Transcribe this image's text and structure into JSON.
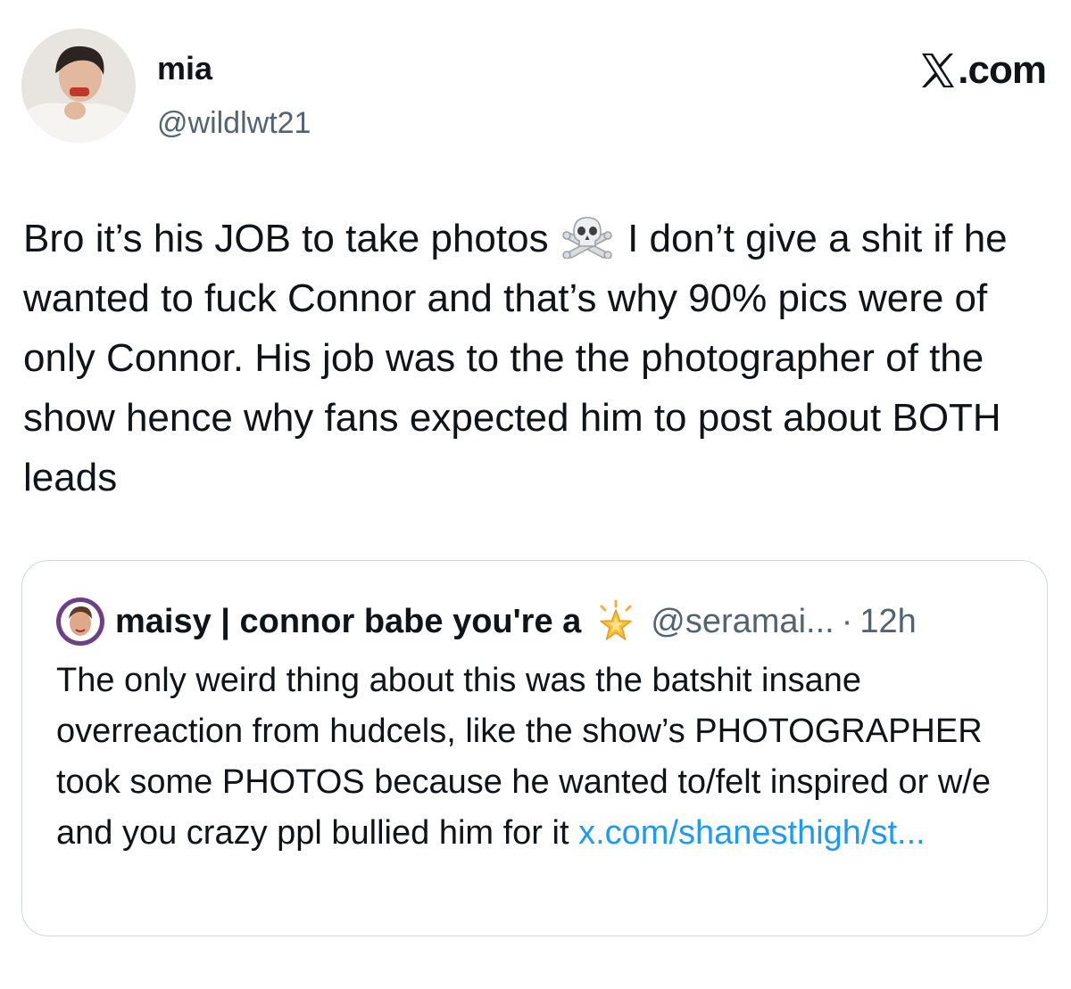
{
  "author": {
    "display_name": "mia",
    "handle": "@wildlwt21"
  },
  "brand": {
    "label": ".com",
    "icon": "x-logo-icon"
  },
  "tweet": {
    "text_before_emoji": "Bro it’s his JOB to take photos",
    "emoji": "skull-and-crossbones-icon",
    "text_after_emoji": "I don’t give a shit if he wanted to fuck Connor and that’s why 90% pics were of only Connor. His job was to the the photographer of the show hence why fans expected him to post about BOTH leads"
  },
  "quoted_tweet": {
    "display_name": "maisy | connor babe you're a",
    "name_emoji": "glowing-star-icon",
    "handle": "@seramai...",
    "separator": "·",
    "time": "12h",
    "text": "The only weird thing about this was the batshit insane overreaction from hudcels, like the show’s PHOTOGRAPHER took some PHOTOS because he wanted to/felt inspired or w/e and you crazy ppl bullied him for it",
    "link": "x.com/shanesthigh/st...",
    "link_color": "#1d9bf0"
  },
  "colors": {
    "text": "#0f1419",
    "secondary": "#536471",
    "border": "#cfd9de"
  }
}
